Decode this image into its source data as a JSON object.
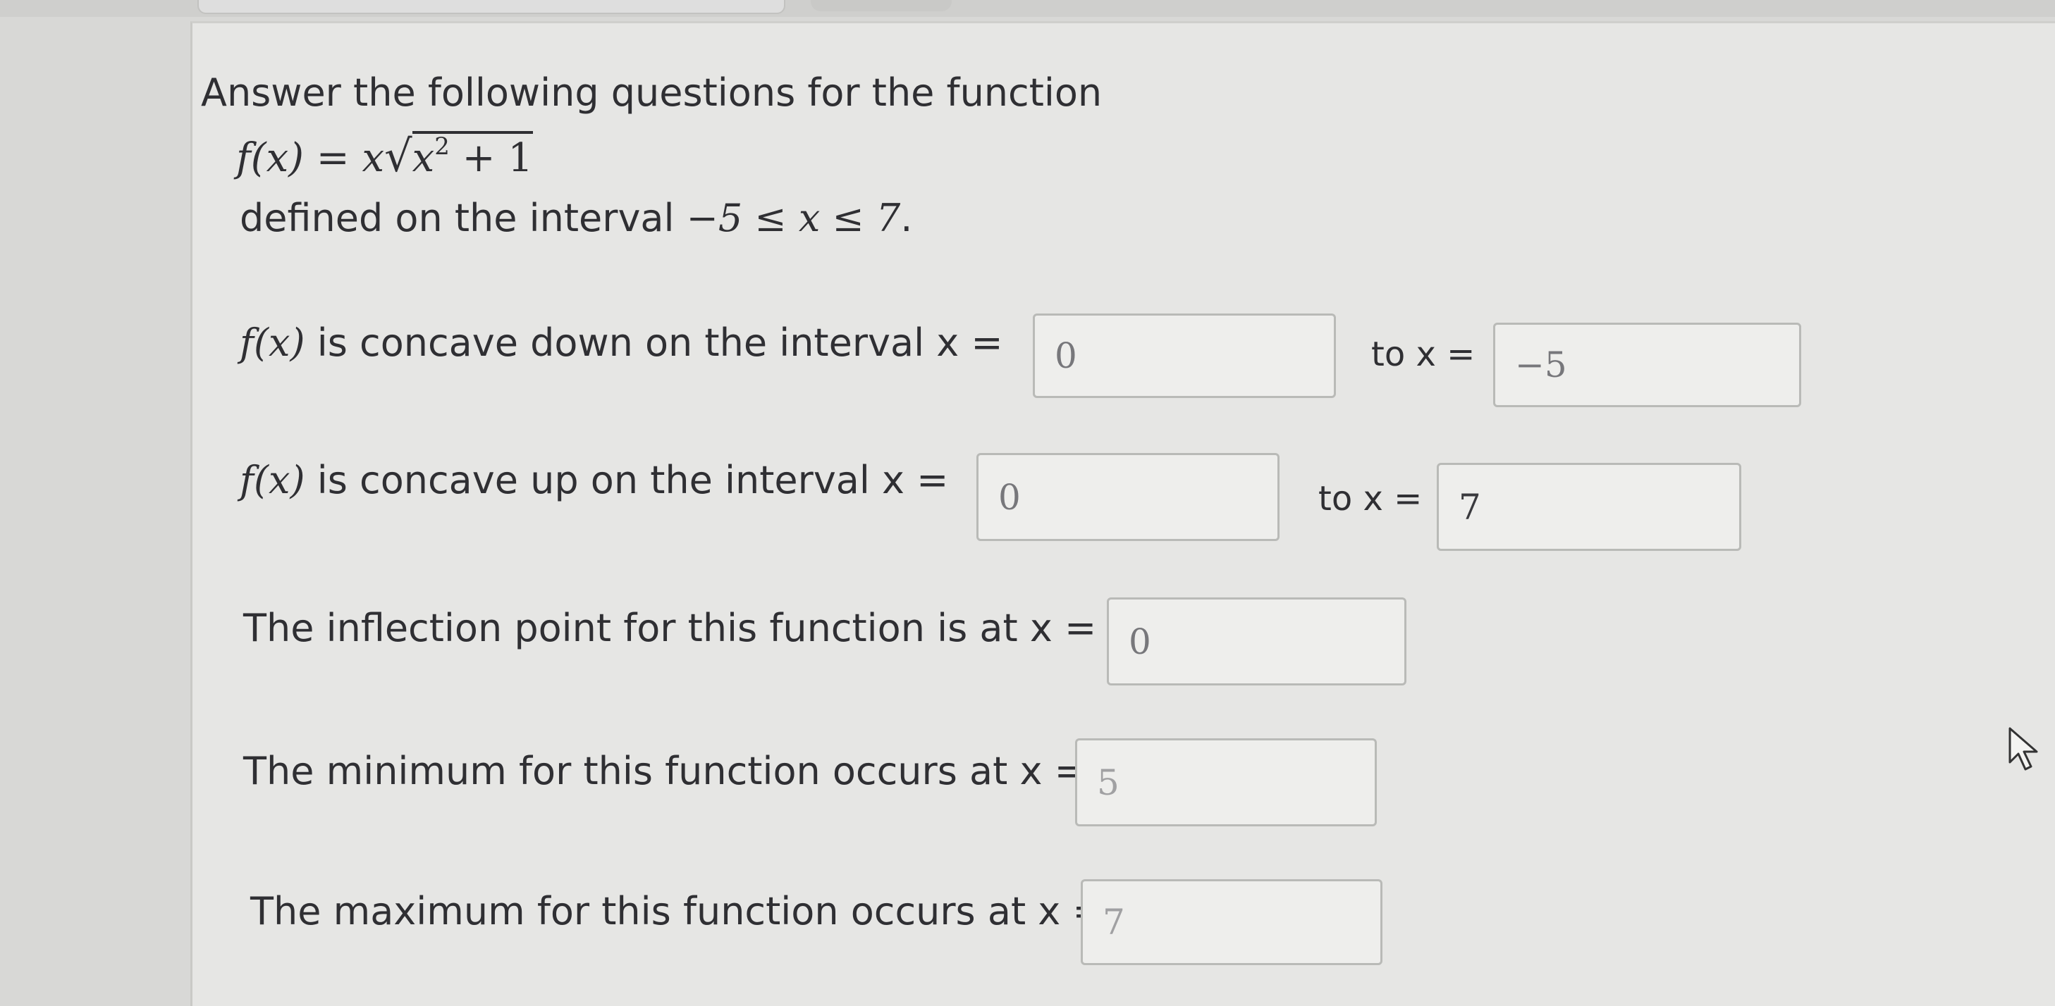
{
  "question": {
    "intro": "Answer the following questions for the function",
    "function": {
      "lhs": "f(x) = x",
      "radicand_base": "x",
      "radicand_exp": "2",
      "radicand_rest": " + 1"
    },
    "domain_prefix": "defined on the interval ",
    "domain_math": "−5 ≤ x ≤ 7",
    "domain_suffix": "."
  },
  "rows": {
    "concave_down": {
      "fx": "f(x)",
      "label": " is concave down on the interval x =",
      "from_value": "0",
      "to_label": "to x =",
      "to_value": "−5"
    },
    "concave_up": {
      "fx": "f(x)",
      "label": " is concave up on the interval x =",
      "from_value": "0",
      "to_label": "to x =",
      "to_value": "7"
    },
    "inflection": {
      "label": "The inflection point for this function is at x =",
      "value": "0"
    },
    "minimum": {
      "label": "The minimum for this function occurs at x =",
      "value": "5"
    },
    "maximum": {
      "label": "The maximum for this function occurs at x =",
      "value": "7"
    }
  },
  "icons": {
    "cursor": "pointer-cursor-icon"
  }
}
